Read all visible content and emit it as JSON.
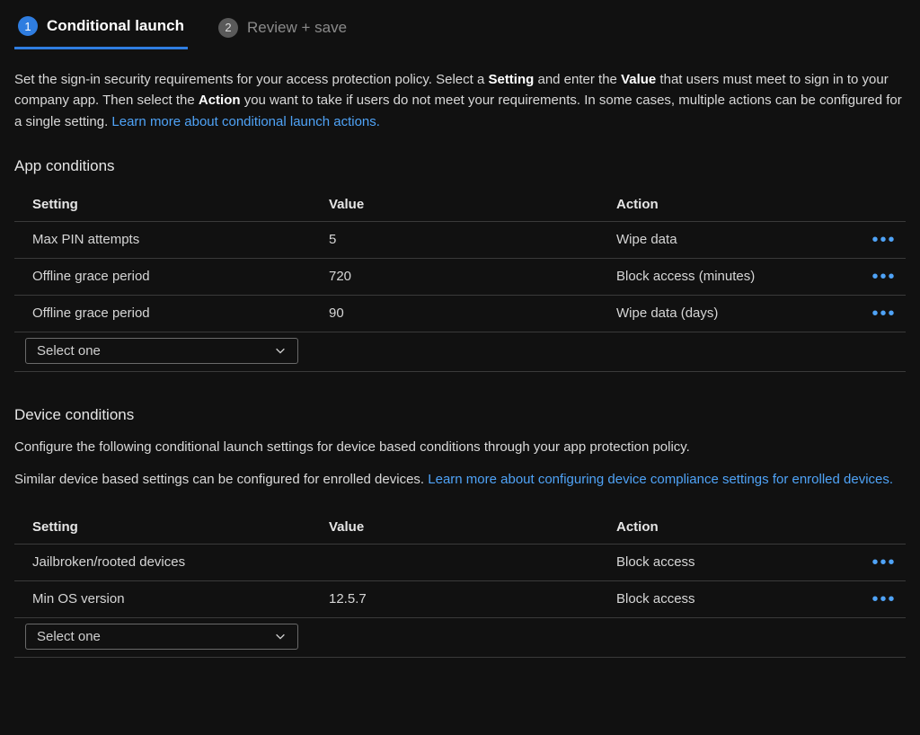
{
  "tabs": [
    {
      "num": "1",
      "label": "Conditional launch"
    },
    {
      "num": "2",
      "label": "Review + save"
    }
  ],
  "intro": {
    "p1a": "Set the sign-in security requirements for your access protection policy. Select a ",
    "b1": "Setting",
    "p1b": " and enter the ",
    "b2": "Value",
    "p1c": " that users must meet to sign in to your company app. Then select the ",
    "b3": "Action",
    "p1d": " you want to take if users do not meet your requirements. In some cases, multiple actions can be configured for a single setting. ",
    "link": "Learn more about conditional launch actions."
  },
  "app": {
    "title": "App conditions",
    "headers": {
      "setting": "Setting",
      "value": "Value",
      "action": "Action"
    },
    "rows": [
      {
        "setting": "Max PIN attempts",
        "value": "5",
        "action": "Wipe data"
      },
      {
        "setting": "Offline grace period",
        "value": "720",
        "action": "Block access (minutes)"
      },
      {
        "setting": "Offline grace period",
        "value": "90",
        "action": "Wipe data (days)"
      }
    ],
    "select_placeholder": "Select one"
  },
  "device": {
    "title": "Device conditions",
    "desc1": "Configure the following conditional launch settings for device based conditions through your app protection policy.",
    "desc2a": "Similar device based settings can be configured for enrolled devices. ",
    "link": "Learn more about configuring device compliance settings for enrolled devices.",
    "headers": {
      "setting": "Setting",
      "value": "Value",
      "action": "Action"
    },
    "rows": [
      {
        "setting": "Jailbroken/rooted devices",
        "value": "",
        "action": "Block access"
      },
      {
        "setting": "Min OS version",
        "value": "12.5.7",
        "action": "Block access"
      }
    ],
    "select_placeholder": "Select one"
  }
}
